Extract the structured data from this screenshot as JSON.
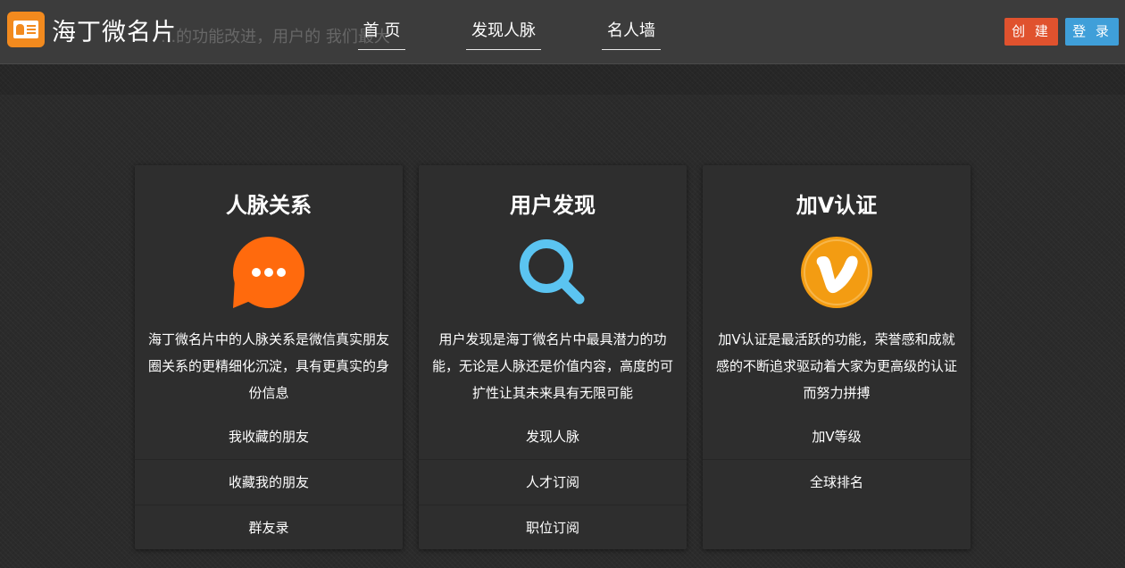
{
  "header": {
    "brand_name": "海丁微名片",
    "ghost_text": "...的功能改进，用户的 我们最大",
    "nav": [
      {
        "label": "首 页"
      },
      {
        "label": "发现人脉"
      },
      {
        "label": "名人墙"
      }
    ],
    "create_label": "创 建",
    "login_label": "登 录"
  },
  "colors": {
    "create_button": "#e0522e",
    "login_button": "#3f9fd9",
    "chat_icon": "#ff6a0d",
    "search_icon": "#5bc4f1",
    "vip_icon": "#f39c12",
    "logo": "#f28a1e"
  },
  "cards": [
    {
      "title": "人脉关系",
      "icon": "chat-bubble-icon",
      "description": "海丁微名片中的人脉关系是微信真实朋友圈关系的更精细化沉淀，具有更真实的身份信息",
      "links": [
        "我收藏的朋友",
        "收藏我的朋友",
        "群友录"
      ]
    },
    {
      "title": "用户发现",
      "icon": "search-icon",
      "description": "用户发现是海丁微名片中最具潜力的功能，无论是人脉还是价值内容，高度的可扩性让其未来具有无限可能",
      "links": [
        "发现人脉",
        "人才订阅",
        "职位订阅"
      ]
    },
    {
      "title": "加V认证",
      "icon": "vip-badge-icon",
      "description": "加V认证是最活跃的功能，荣誉感和成就感的不断追求驱动着大家为更高级的认证而努力拼搏",
      "links": [
        "加V等级",
        "全球排名"
      ]
    }
  ]
}
